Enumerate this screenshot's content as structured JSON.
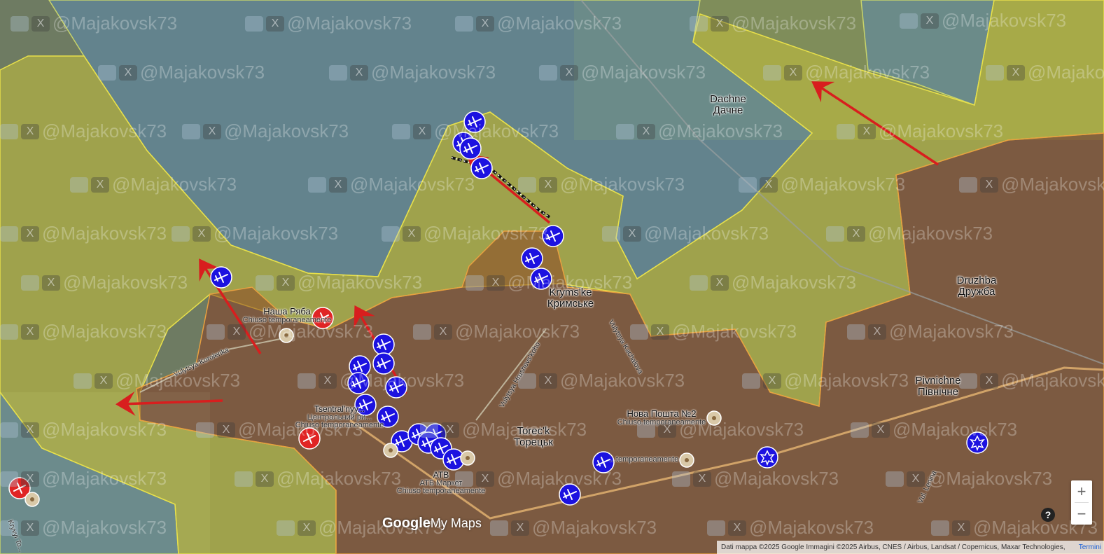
{
  "map": {
    "places": [
      {
        "name": "Dachne",
        "alt": "Дачне"
      },
      {
        "name": "Krymsʹke",
        "alt": "Кримське"
      },
      {
        "name": "Druzhba",
        "alt": "Дружба"
      },
      {
        "name": "Pivnichne",
        "alt": "Північне"
      },
      {
        "name": "Torecʹk",
        "alt": "Торецьк"
      }
    ],
    "pois": [
      {
        "name": "Наша Ряба",
        "status": "Chiuso temporaneamente"
      },
      {
        "name": "Tsentral'nyy...",
        "alt": "Центральний ри...",
        "status": "Chiuso temporaneamente"
      },
      {
        "name": "Нова Пошта №2",
        "status": "Chiuso temporaneamente"
      },
      {
        "name": "ATB",
        "alt": "АТБ Маркет",
        "status": "Chiuso temporaneamente"
      },
      {
        "name": "...temporaneamente"
      }
    ],
    "streets": [
      "Vulytsya Korolenka",
      "Vulytsya Hrushevs'koho",
      "Vulytsya Kachalova",
      "Vul. Lenina",
      "Kryvyi To..."
    ],
    "watermark": "@Majakovsk73",
    "colors": {
      "zone_blue": "#5b8bb0",
      "zone_yellow": "#c9c23a",
      "zone_red": "#8a3a20",
      "arrow": "#d81e1e",
      "marker_blue": "#1c12e0",
      "marker_red": "#e02424"
    }
  },
  "controls": {
    "zoom_in": "+",
    "zoom_out": "−",
    "help": "?"
  },
  "brand": {
    "google": "Google",
    "my_maps": "My Maps"
  },
  "attribution": {
    "text": "Dati mappa ©2025 Google Immagini ©2025 Airbus, CNES / Airbus, Landsat / Copernicus, Maxar Technologies,",
    "terms": "Termini"
  }
}
